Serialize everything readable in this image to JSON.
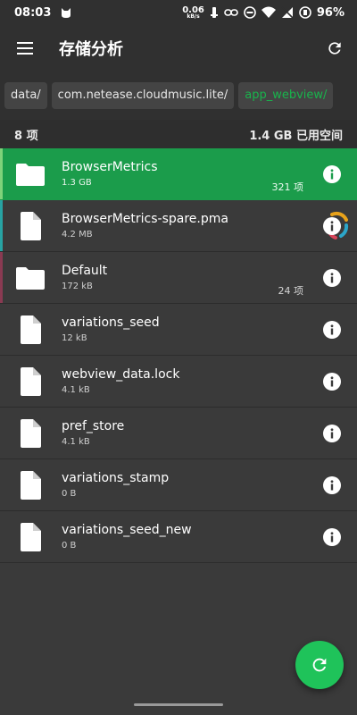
{
  "status_bar": {
    "time": "08:03",
    "net_speed_value": "0.06",
    "net_speed_unit": "kB/s",
    "battery": "96%"
  },
  "app_bar": {
    "title": "存储分析"
  },
  "breadcrumbs": [
    {
      "label": "data/"
    },
    {
      "label": "com.netease.cloudmusic.lite/"
    },
    {
      "label": "app_webview/"
    }
  ],
  "summary": {
    "item_count": "8 项",
    "used_space": "1.4 GB 已用空间"
  },
  "files": [
    {
      "name": "BrowserMetrics",
      "size": "1.3 GB",
      "count": "321 项",
      "type": "folder"
    },
    {
      "name": "BrowserMetrics-spare.pma",
      "size": "4.2 MB",
      "count": "",
      "type": "file"
    },
    {
      "name": "Default",
      "size": "172 kB",
      "count": "24 项",
      "type": "folder"
    },
    {
      "name": "variations_seed",
      "size": "12 kB",
      "count": "",
      "type": "file"
    },
    {
      "name": "webview_data.lock",
      "size": "4.1 kB",
      "count": "",
      "type": "file"
    },
    {
      "name": "pref_store",
      "size": "4.1 kB",
      "count": "",
      "type": "file"
    },
    {
      "name": "variations_stamp",
      "size": "0 B",
      "count": "",
      "type": "file"
    },
    {
      "name": "variations_seed_new",
      "size": "0 B",
      "count": "",
      "type": "file"
    }
  ],
  "colors": {
    "background": "#3a3a3a",
    "accent_green": "#1b9c4b",
    "fab_green": "#1fc35a",
    "breadcrumb_active": "#19b34c"
  },
  "icons": {
    "menu": "menu-icon",
    "refresh": "refresh-icon",
    "folder": "folder-icon",
    "file": "file-icon",
    "info": "info-icon",
    "fab": "refresh-icon"
  }
}
